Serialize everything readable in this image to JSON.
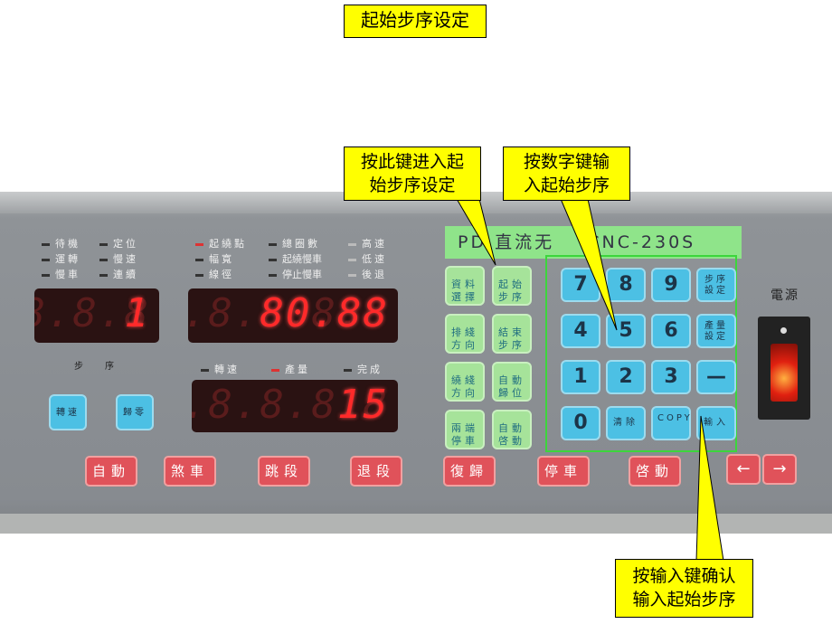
{
  "title": "起始步序设定",
  "callouts": {
    "enter_key": "按此键进入起始步序设定",
    "enter_key_l1": "按此键进入起",
    "enter_key_l2": "始步序设定",
    "digits_l1": "按数字键输",
    "digits_l2": "入起始步序",
    "confirm_l1": "按输入键确认",
    "confirm_l2": "输入起始步序"
  },
  "panel": {
    "model": "PD 直流无刷 CNC-230S",
    "model_visible": "PD 直流无    CNC-230S",
    "indicators_left": [
      "待機",
      "定位",
      "運轉",
      "慢速",
      "慢車",
      "連續"
    ],
    "indicators_mid": [
      "起繞點",
      "總圈數",
      "高速",
      "幅寬",
      "起繞慢車",
      "低速",
      "線徑",
      "停止慢車",
      "後退"
    ],
    "indicators_lower": [
      "轉速",
      "產量",
      "完成"
    ],
    "step_label": "步序",
    "displays": {
      "step": "1",
      "step_ghost": "8.8.8.8",
      "main": "80.88",
      "main_ghost": "8.8.8.8.8",
      "count": "15",
      "count_ghost": "8.8.8.8.8"
    },
    "blue_small": [
      "轉速",
      "歸零"
    ],
    "green_keys": [
      [
        "資料",
        "選擇"
      ],
      [
        "起始",
        "步序"
      ],
      [
        "排綫",
        "方向"
      ],
      [
        "結束",
        "步序"
      ],
      [
        "繞綫",
        "方向"
      ],
      [
        "自動",
        "歸位"
      ],
      [
        "兩端",
        "停車"
      ],
      [
        "自動",
        "啓動"
      ]
    ],
    "keypad": [
      [
        "7",
        "8",
        "9",
        "步序設定"
      ],
      [
        "4",
        "5",
        "6",
        "產量設定"
      ],
      [
        "1",
        "2",
        "3",
        "—"
      ],
      [
        "0",
        "清除",
        "COPY",
        "輸入"
      ]
    ],
    "power_label": "電源",
    "bottom_keys": [
      "自動",
      "煞車",
      "跳段",
      "退段",
      "復歸",
      "停車",
      "啓動"
    ],
    "arrow_keys": [
      "←",
      "→"
    ]
  },
  "colors": {
    "callout": "#ffff00",
    "display_lit": "#ff2a2a",
    "green_key": "#a6e39a",
    "blue_key": "#4cc0e4",
    "red_key": "#e0525a",
    "panel": "#8e9297"
  }
}
